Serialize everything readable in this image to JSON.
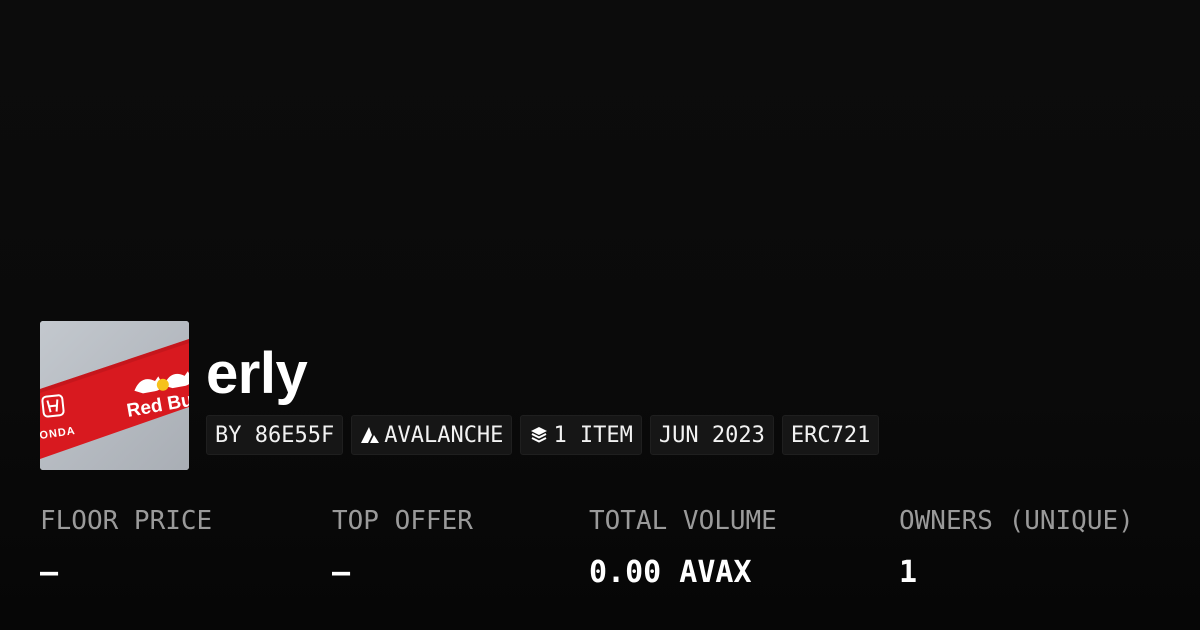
{
  "collection": {
    "name": "erly",
    "image_alt": "Red Bull Honda banner"
  },
  "tags": {
    "creator": "BY 86E55F",
    "chain": "AVALANCHE",
    "items": "1 ITEM",
    "date": "JUN 2023",
    "standard": "ERC721"
  },
  "stats": {
    "floor_price": {
      "label": "FLOOR PRICE",
      "value": "–"
    },
    "top_offer": {
      "label": "TOP OFFER",
      "value": "–"
    },
    "total_volume": {
      "label": "TOTAL VOLUME",
      "value": "0.00 AVAX"
    },
    "owners": {
      "label": "OWNERS (UNIQUE)",
      "value": "1"
    }
  },
  "thumbnail_text": {
    "brand_left": "ONDA",
    "brand_right": "Red Bu"
  },
  "colors": {
    "background": "#0b0b0b",
    "tag_bg": "#161616",
    "label": "#9a9a9a",
    "banner_red": "#d8191f"
  },
  "icons": {
    "chain": "avalanche-icon",
    "items": "layers-icon"
  }
}
